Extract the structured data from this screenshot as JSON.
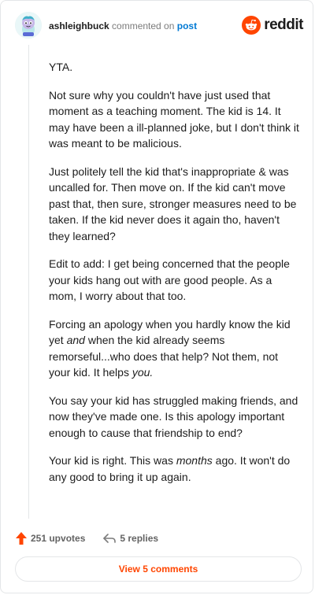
{
  "header": {
    "username": "ashleighbuck",
    "action_text": "commented on",
    "link_text": "post",
    "brand": "reddit"
  },
  "comment": {
    "paragraphs": [
      [
        {
          "text": "YTA."
        }
      ],
      [
        {
          "text": "Not sure why you couldn't have just used that moment as a teaching moment. The kid is 14. It may have been a ill-planned joke, but I don't think it was meant to be malicious."
        }
      ],
      [
        {
          "text": "Just politely tell the kid that's inappropriate & was uncalled for. Then move on. If the kid can't move past that, then sure, stronger measures need to be taken. If the kid never does it again tho, haven't they learned?"
        }
      ],
      [
        {
          "text": "Edit to add: I get being concerned that the people your kids hang out with are good people. As a mom, I worry about that too."
        }
      ],
      [
        {
          "text": "Forcing an apology when you hardly know the kid yet "
        },
        {
          "text": "and",
          "italic": true
        },
        {
          "text": " when the kid already seems remorseful...who does that help? Not them, not your kid. It helps "
        },
        {
          "text": "you.",
          "italic": true
        }
      ],
      [
        {
          "text": "You say your kid has struggled making friends, and now they've made one. Is this apology important enough to cause that friendship to end?"
        }
      ],
      [
        {
          "text": "Your kid is right. This was "
        },
        {
          "text": "months",
          "italic": true
        },
        {
          "text": " ago. It won't do any good to bring it up again."
        }
      ]
    ]
  },
  "footer": {
    "upvotes": "251 upvotes",
    "replies": "5 replies",
    "view_comments": "View 5 comments"
  },
  "colors": {
    "accent": "#ff4500",
    "link": "#0079d3",
    "muted": "#7c7c7c",
    "border": "#e4e6e8"
  },
  "icons": {
    "avatar": "snoo-avatar",
    "brand": "reddit-logo-icon",
    "upvote": "upvote-arrow-icon",
    "reply": "reply-arrow-icon"
  }
}
